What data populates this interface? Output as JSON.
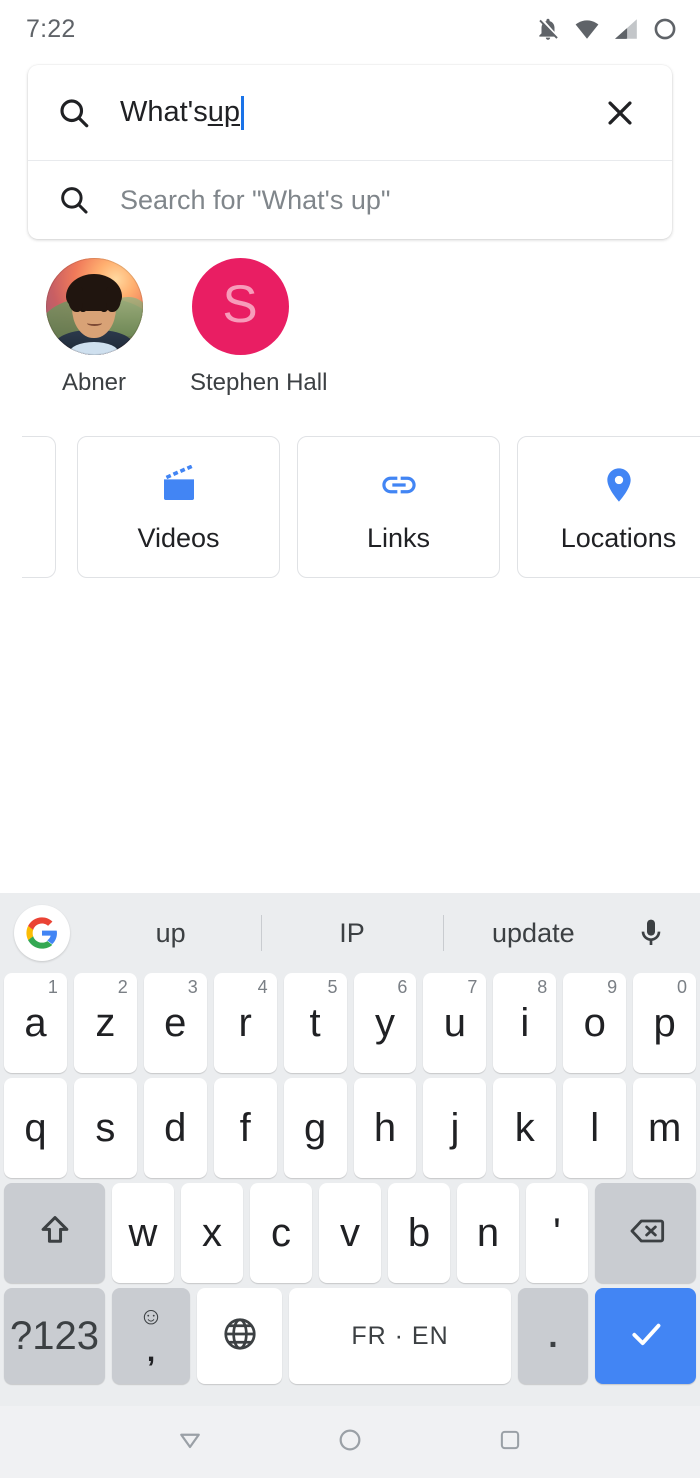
{
  "status_bar": {
    "time": "7:22",
    "icons": [
      "notifications-off-icon",
      "wifi-icon",
      "cellular-signal-icon",
      "battery-circle-icon"
    ]
  },
  "search": {
    "leading_icon": "search-icon",
    "query_prefix": "What's ",
    "query_composing": "up",
    "clear_icon": "close-icon",
    "suggestion_icon": "search-icon",
    "suggestion_text": "Search for \"What's up\""
  },
  "contacts": [
    {
      "name": "Abner",
      "avatar_type": "photo",
      "initial": ""
    },
    {
      "name": "Stephen Hall",
      "avatar_type": "initial",
      "initial": "S",
      "color": "#E91E63"
    }
  ],
  "categories": [
    {
      "label": "Videos",
      "icon": "video-clapperboard-icon",
      "color": "#4285F4"
    },
    {
      "label": "Links",
      "icon": "link-chain-icon",
      "color": "#4285F4"
    },
    {
      "label": "Locations",
      "icon": "map-pin-icon",
      "color": "#4285F4"
    }
  ],
  "keyboard": {
    "logo": "google-g-icon",
    "suggestions": [
      "up",
      "IP",
      "update"
    ],
    "mic_icon": "microphone-icon",
    "row1": [
      {
        "ch": "a",
        "num": "1"
      },
      {
        "ch": "z",
        "num": "2"
      },
      {
        "ch": "e",
        "num": "3"
      },
      {
        "ch": "r",
        "num": "4"
      },
      {
        "ch": "t",
        "num": "5"
      },
      {
        "ch": "y",
        "num": "6"
      },
      {
        "ch": "u",
        "num": "7"
      },
      {
        "ch": "i",
        "num": "8"
      },
      {
        "ch": "o",
        "num": "9"
      },
      {
        "ch": "p",
        "num": "0"
      }
    ],
    "row2": [
      {
        "ch": "q"
      },
      {
        "ch": "s"
      },
      {
        "ch": "d"
      },
      {
        "ch": "f"
      },
      {
        "ch": "g"
      },
      {
        "ch": "h"
      },
      {
        "ch": "j"
      },
      {
        "ch": "k"
      },
      {
        "ch": "l"
      },
      {
        "ch": "m"
      }
    ],
    "row3": [
      {
        "ch": "w"
      },
      {
        "ch": "x"
      },
      {
        "ch": "c"
      },
      {
        "ch": "v"
      },
      {
        "ch": "b"
      },
      {
        "ch": "n"
      },
      {
        "ch": "'"
      }
    ],
    "shift_icon": "shift-arrow-icon",
    "backspace_icon": "backspace-icon",
    "symbols_label": "?123",
    "emoji_icon": "emoji-smiley-icon",
    "comma_label": ",",
    "globe_icon": "language-globe-icon",
    "space_label": "FR · EN",
    "period_label": ".",
    "enter_icon": "checkmark-icon",
    "enter_color": "#4285F4"
  },
  "nav_bar": {
    "back_icon": "collapse-keyboard-triangle-icon",
    "home_icon": "home-circle-icon",
    "recents_icon": "recents-square-icon"
  }
}
